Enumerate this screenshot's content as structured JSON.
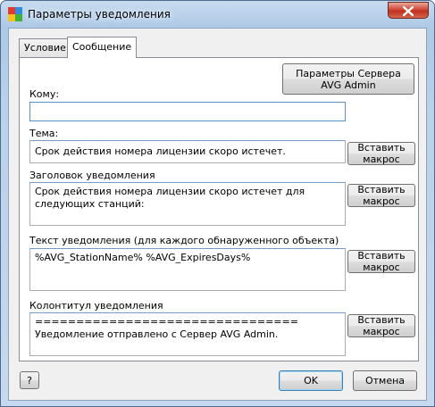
{
  "window": {
    "title": "Параметры уведомления"
  },
  "tabs": [
    {
      "label": "Условие"
    },
    {
      "label": "Сообщение"
    }
  ],
  "server_button": {
    "label": "Параметры Сервера AVG Admin"
  },
  "to": {
    "label": "Кому:",
    "value": ""
  },
  "subject": {
    "label": "Тема:",
    "value": "Срок действия номера лицензии скоро истечет."
  },
  "header": {
    "label": "Заголовок уведомления",
    "value": "Срок действия номера лицензии скоро истечет для следующих станций:"
  },
  "body": {
    "label": "Текст уведомления (для каждого обнаруженного объекта)",
    "value": "%AVG_StationName% %AVG_ExpiresDays%"
  },
  "footer": {
    "label": "Колонтитул уведомления",
    "value": "================================\nУведомление отправлено с Сервер AVG Admin."
  },
  "insert_macro_label": "Вставить макрос",
  "help_button": {
    "label": "?"
  },
  "ok_button": {
    "label": "OK"
  },
  "cancel_button": {
    "label": "Отмена"
  },
  "colors": {
    "close": "#c0301f",
    "title_bar": "#aec9e6",
    "focus_border": "#5a93c7"
  }
}
